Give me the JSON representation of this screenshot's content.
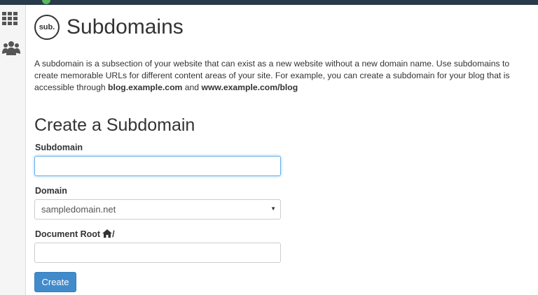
{
  "header": {
    "icon_text": "sub.",
    "title": "Subdomains"
  },
  "description": {
    "text_1": "A subdomain is a subsection of your website that can exist as a new website without a new domain name. Use subdomains to create memorable URLs for different content areas of your site. For example, you can create a subdomain for your blog that is accessible through ",
    "example_1": "blog.example.com",
    "text_2": " and ",
    "example_2": "www.example.com/blog"
  },
  "form": {
    "title": "Create a Subdomain",
    "subdomain_label": "Subdomain",
    "subdomain_value": "",
    "domain_label": "Domain",
    "domain_selected": "sampledomain.net",
    "docroot_label": "Document Root",
    "docroot_suffix": "/",
    "docroot_value": "",
    "create_label": "Create"
  },
  "sidebar": {
    "items": [
      {
        "icon": "grid-icon"
      },
      {
        "icon": "users-icon"
      }
    ]
  },
  "colors": {
    "topbar": "#293a4a",
    "primary_button": "#428bca",
    "focus_border": "#66afe9"
  }
}
